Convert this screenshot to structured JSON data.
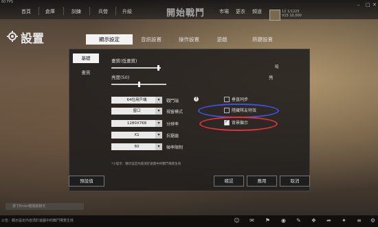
{
  "topbar": {
    "fps_label": "60 FPS",
    "nav_items": [
      "首頁",
      "倉庫",
      "訓鍊",
      "兵營",
      "升級"
    ],
    "game_title": "開始戰鬥",
    "market_label": "市場",
    "nav_items_right": [
      "更衣",
      "頻道"
    ],
    "status_lines": [
      "12 1/1225",
      "V15 10,000"
    ]
  },
  "settings": {
    "title": "設置",
    "tabs": [
      "顯示設定",
      "音訊設置",
      "操作設置",
      "遊戲",
      "熱鍵設置"
    ],
    "side_tabs": [
      "基礎",
      "畫質"
    ],
    "quality_label": "畫質(低畫質)",
    "brightness_label": "亮度(50)",
    "quality_value": 0.95,
    "brightness_value": 0.5,
    "low_label": "暗",
    "high_label": "亮",
    "selects": [
      {
        "value": "64位用戶端",
        "label": "戰鬥端"
      },
      {
        "value": "窗口",
        "label": "視窗模式"
      },
      {
        "value": "1280X768",
        "label": "分辨率"
      },
      {
        "value": "X1",
        "label": "抗鋸齒"
      },
      {
        "value": "60",
        "label": "幀率限制"
      }
    ],
    "info_icon_text": "!",
    "checkboxes": [
      {
        "label": "垂直同步",
        "checked": false
      },
      {
        "label": "隱藏隊友特效",
        "checked": false
      },
      {
        "label": "背景顯示",
        "checked": true
      }
    ],
    "note": "*小提示：顯示設定內容須於遊戲中的戰鬥場景生效",
    "buttons": {
      "default": "預設值",
      "confirm": "確認",
      "apply": "應用",
      "cancel": "取消"
    }
  },
  "colors": {
    "blue_circle": "#3a55e6",
    "red_circle": "#e8313b"
  },
  "bottom": {
    "chat_placeholder": "按下Enter鍵開啟聊天",
    "message": "公告：顯示設定內容須於遊戲中的戰鬥場景生效"
  }
}
